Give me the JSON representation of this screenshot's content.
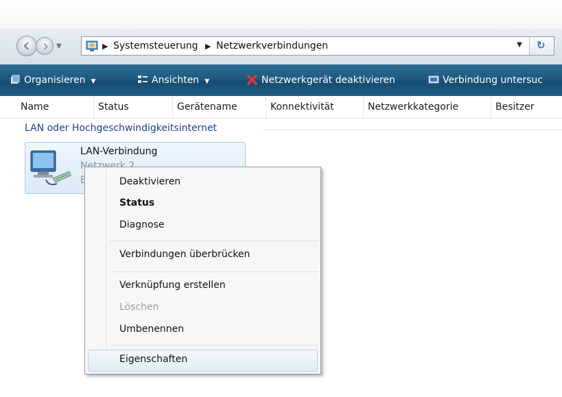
{
  "address": {
    "crumbs": [
      "Systemsteuerung",
      "Netzwerkverbindungen"
    ]
  },
  "toolbar": {
    "organize": "Organisieren",
    "views": "Ansichten",
    "disable_device": "Netzwerkgerät deaktivieren",
    "diagnose": "Verbindung untersuc"
  },
  "columns": [
    "Name",
    "Status",
    "Gerätename",
    "Konnektivität",
    "Netzwerkkategorie",
    "Besitzer"
  ],
  "group": {
    "title": "LAN oder Hochgeschwindigkeitsinternet"
  },
  "item": {
    "name": "LAN-Verbindung",
    "status": "Netzwerk 2",
    "device": "E"
  },
  "context_menu": {
    "items": [
      "Deaktivieren",
      "Status",
      "Diagnose",
      "Verbindungen überbrücken",
      "Verknüpfung erstellen",
      "Löschen",
      "Umbenennen",
      "Eigenschaften"
    ]
  },
  "icons": {
    "back": "back-arrow-icon",
    "forward": "forward-arrow-icon",
    "folder": "control-panel-icon",
    "refresh": "refresh-icon",
    "organize": "organize-icon",
    "views": "views-icon",
    "disable": "disable-network-icon",
    "diagnose": "diagnose-icon",
    "network": "network-adapter-icon"
  },
  "colors": {
    "commandbar": "#1e5a80",
    "group_title": "#1e3f9a",
    "disable_icon": "#d9332b"
  }
}
